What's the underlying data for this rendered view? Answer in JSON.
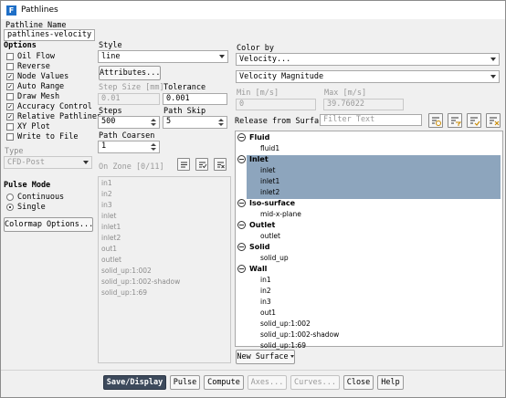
{
  "window": {
    "title": "Pathlines"
  },
  "pathline_name": {
    "label": "Pathline Name",
    "value": "pathlines-velocity"
  },
  "options": {
    "label": "Options",
    "items": [
      {
        "label": "Oil Flow",
        "checked": false
      },
      {
        "label": "Reverse",
        "checked": false
      },
      {
        "label": "Node Values",
        "checked": true
      },
      {
        "label": "Auto Range",
        "checked": true
      },
      {
        "label": "Draw Mesh",
        "checked": false
      },
      {
        "label": "Accuracy Control",
        "checked": true
      },
      {
        "label": "Relative Pathlines",
        "checked": true
      },
      {
        "label": "XY Plot",
        "checked": false
      },
      {
        "label": "Write to File",
        "checked": false
      }
    ]
  },
  "type": {
    "label": "Type",
    "value": "CFD-Post"
  },
  "pulse_mode": {
    "label": "Pulse Mode",
    "options": [
      {
        "label": "Continuous",
        "selected": false
      },
      {
        "label": "Single",
        "selected": true
      }
    ]
  },
  "colormap_button": "Colormap Options...",
  "style": {
    "label": "Style",
    "value": "line",
    "attributes_button": "Attributes..."
  },
  "step_size": {
    "label": "Step Size [mm]",
    "value": "0.01"
  },
  "tolerance": {
    "label": "Tolerance",
    "value": "0.001"
  },
  "steps": {
    "label": "Steps",
    "value": "500"
  },
  "path_skip": {
    "label": "Path Skip",
    "value": "5"
  },
  "path_coarsen": {
    "label": "Path Coarsen",
    "value": "1"
  },
  "on_zone": {
    "label": "On Zone [0/11]",
    "items": [
      "in1",
      "in2",
      "in3",
      "inlet",
      "inlet1",
      "inlet2",
      "out1",
      "outlet",
      "solid_up:1:002",
      "solid_up:1:002-shadow",
      "solid_up:1:69"
    ]
  },
  "color_by": {
    "label": "Color by",
    "category": "Velocity...",
    "field": "Velocity Magnitude"
  },
  "range": {
    "min_label": "Min [m/s]",
    "min_value": "0",
    "max_label": "Max [m/s]",
    "max_value": "39.76022"
  },
  "release": {
    "label": "Release from Surfaces",
    "filter_placeholder": "Filter Text"
  },
  "surfaces": [
    {
      "group": "Fluid",
      "items": [
        {
          "name": "fluid1",
          "selected": false
        }
      ]
    },
    {
      "group": "Inlet",
      "selected": true,
      "items": [
        {
          "name": "inlet",
          "selected": true
        },
        {
          "name": "inlet1",
          "selected": true
        },
        {
          "name": "inlet2",
          "selected": true
        }
      ]
    },
    {
      "group": "Iso-surface",
      "items": [
        {
          "name": "mid-x-plane",
          "selected": false
        }
      ]
    },
    {
      "group": "Outlet",
      "items": [
        {
          "name": "outlet",
          "selected": false
        }
      ]
    },
    {
      "group": "Solid",
      "items": [
        {
          "name": "solid_up",
          "selected": false
        }
      ]
    },
    {
      "group": "Wall",
      "items": [
        {
          "name": "in1"
        },
        {
          "name": "in2"
        },
        {
          "name": "in3"
        },
        {
          "name": "out1"
        },
        {
          "name": "solid_up:1:002"
        },
        {
          "name": "solid_up:1:002-shadow"
        },
        {
          "name": "solid_up:1:69"
        }
      ]
    }
  ],
  "new_surface_button": "New Surface",
  "footer": {
    "save_display": "Save/Display",
    "pulse": "Pulse",
    "compute": "Compute",
    "axes": "Axes...",
    "curves": "Curves...",
    "close": "Close",
    "help": "Help"
  },
  "colors": {
    "selection": "#8da5bd",
    "primary_button": "#3d4a5c"
  }
}
